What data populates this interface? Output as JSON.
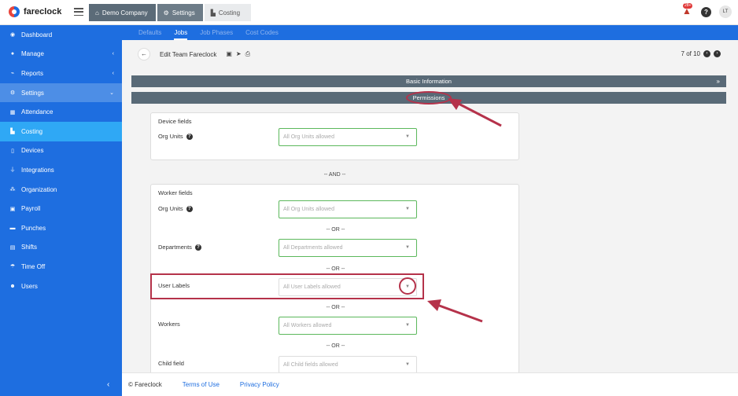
{
  "app": {
    "name": "fareclock"
  },
  "breadcrumb": [
    {
      "label": "Demo Company",
      "icon": "home-icon"
    },
    {
      "label": "Settings",
      "icon": "gear-icon"
    },
    {
      "label": "Costing",
      "icon": "costing-icon"
    }
  ],
  "header": {
    "notifications": "28+",
    "help": "?",
    "avatar": "LT"
  },
  "sidebar": {
    "items": [
      {
        "label": "Dashboard",
        "icon": "dashboard-icon"
      },
      {
        "label": "Manage",
        "icon": "person-icon",
        "chevron": "‹"
      },
      {
        "label": "Reports",
        "icon": "chart-icon",
        "chevron": "‹"
      },
      {
        "label": "Settings",
        "icon": "gear-icon",
        "chevron": "⌄"
      },
      {
        "label": "Attendance",
        "icon": "attendance-icon"
      },
      {
        "label": "Costing",
        "icon": "costing-icon"
      },
      {
        "label": "Devices",
        "icon": "device-icon"
      },
      {
        "label": "Integrations",
        "icon": "plug-icon"
      },
      {
        "label": "Organization",
        "icon": "org-icon"
      },
      {
        "label": "Payroll",
        "icon": "payroll-icon"
      },
      {
        "label": "Punches",
        "icon": "punch-icon"
      },
      {
        "label": "Shifts",
        "icon": "shift-icon"
      },
      {
        "label": "Time Off",
        "icon": "timeoff-icon"
      },
      {
        "label": "Users",
        "icon": "users-icon"
      }
    ],
    "collapse": "‹"
  },
  "tabs": [
    "Defaults",
    "Jobs",
    "Job Phases",
    "Cost Codes"
  ],
  "page": {
    "title": "Edit Team Fareclock",
    "pager": "7 of 10",
    "sections": {
      "basic": "Basic Information",
      "permissions": "Permissions"
    }
  },
  "device_fields": {
    "heading": "Device fields",
    "org_units_label": "Org Units",
    "org_units_placeholder": "All Org Units allowed"
  },
  "and_label": "-- AND --",
  "worker_fields": {
    "heading": "Worker fields",
    "org_units_label": "Org Units",
    "org_units_placeholder": "All Org Units allowed",
    "or_label": "-- OR --",
    "departments_label": "Departments",
    "departments_placeholder": "All Departments allowed",
    "user_labels_label": "User Labels",
    "user_labels_placeholder": "All User Labels allowed",
    "workers_label": "Workers",
    "workers_placeholder": "All Workers allowed",
    "child_field_label": "Child field",
    "child_field_placeholder": "All Child fields allowed"
  },
  "footer": {
    "copyright": "© Fareclock",
    "terms": "Terms of Use",
    "privacy": "Privacy Policy"
  },
  "annotation_color": "#b5324a"
}
